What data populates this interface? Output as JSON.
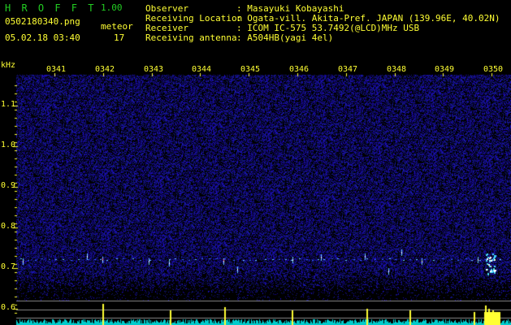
{
  "header": {
    "app_title": "H R O F F T",
    "version": "1.00",
    "filename": "0502180340.png",
    "datetime": "05.02.18 03:40",
    "meteor_label": "meteor",
    "meteor_count": "17",
    "info_labels": [
      "Observer",
      "Receiving Location",
      "Receiver",
      "Receiving antenna"
    ],
    "info_values": [
      ": Masayuki Kobayashi",
      ": Ogata-vill. Akita-Pref. JAPAN (139.96E, 40.02N)",
      ": ICOM IC-575 53.7492(@LCD)MHz USB",
      ": A504HB(yagi 4el)"
    ]
  },
  "axis": {
    "unit": "kHz",
    "y_ticks": [
      "1.1",
      "1.0",
      "0.9",
      "0.8",
      "0.7",
      "0.6"
    ],
    "time_ticks": [
      "0341",
      "0342",
      "0343",
      "0344",
      "0345",
      "0346",
      "0347",
      "0348",
      "0349",
      "0350"
    ]
  },
  "colors": {
    "text": "#ffff33",
    "title": "#22cc22",
    "background_noise": "#0c0c90",
    "meteor_trace": "#66ccff"
  }
}
